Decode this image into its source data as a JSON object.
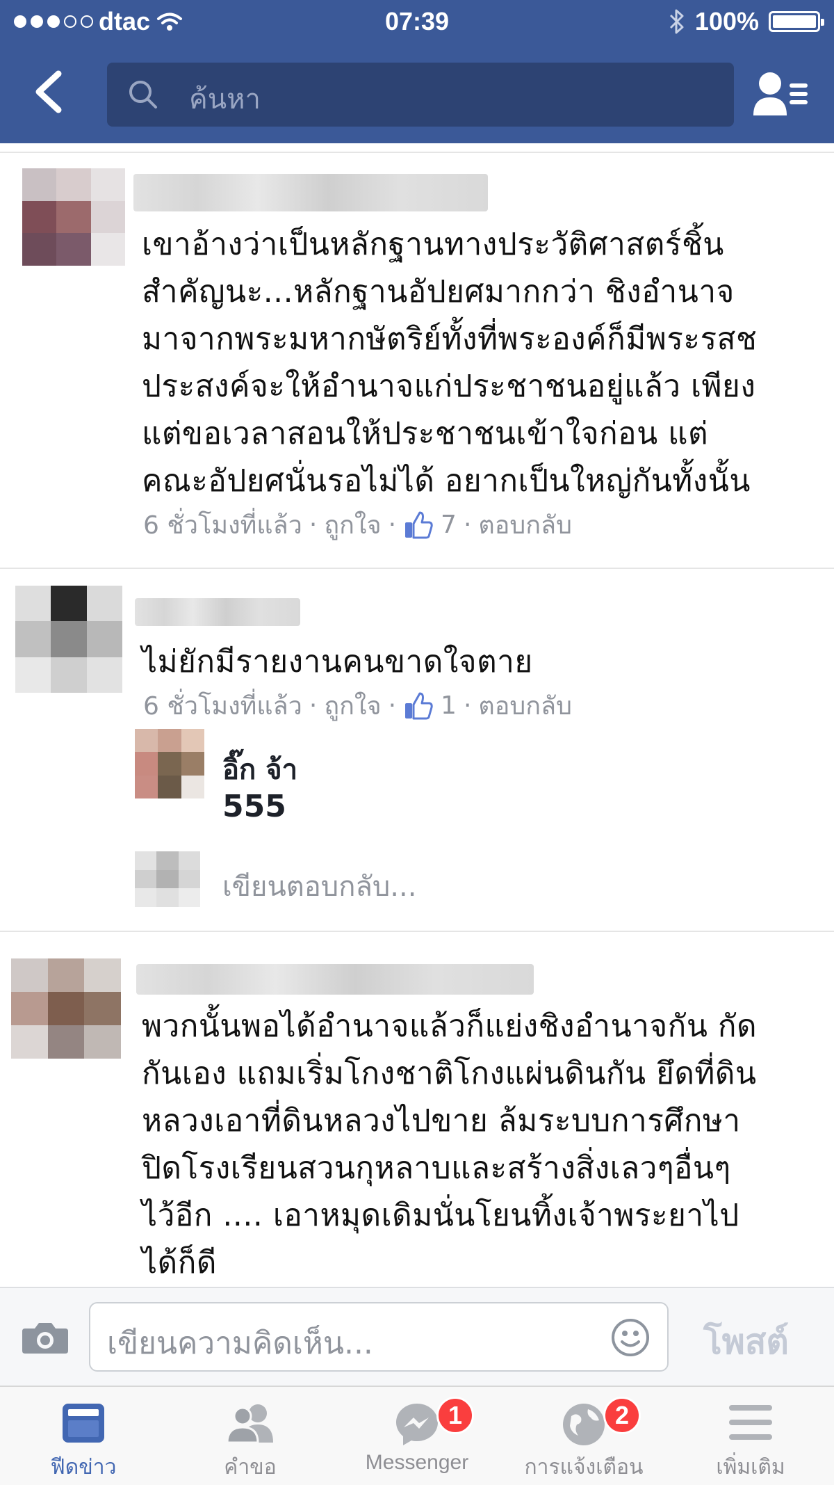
{
  "status_bar": {
    "carrier": "dtac",
    "time": "07:39",
    "battery": "100%"
  },
  "nav": {
    "search_placeholder": "ค้นหา"
  },
  "comments": [
    {
      "text": "เขาอ้างว่าเป็นหลักฐานทางประวัติศาสตร์ชิ้น\nสำคัญนะ...หลักฐานอัปยศมากกว่า  ชิงอำนาจ\nมาจากพระมหากษัตริย์ทั้งที่พระองค์ก็มีพระรสช\nประสงค์จะให้อำนาจแก่ประชาชนอยู่แล้ว เพียง\nแต่ขอเวลาสอนให้ประชาชนเข้าใจก่อน  แต่\nคณะอัปยศนั่นรอไม่ได้  อยากเป็นใหญ่กันทั้งนั้น",
      "time": "6 ชั่วโมงที่แล้ว",
      "like_label": "ถูกใจ",
      "likes": "7",
      "reply_label": "ตอบกลับ"
    },
    {
      "text": "ไม่ยักมีรายงานคนขาดใจตาย",
      "time": "6 ชั่วโมงที่แล้ว",
      "like_label": "ถูกใจ",
      "likes": "1",
      "reply_label": "ตอบกลับ",
      "reply": {
        "name": "อิ๊ก จ้า",
        "text": "555"
      },
      "write_reply": "เขียนตอบกลับ..."
    },
    {
      "text": "พวกนั้นพอได้อำนาจแล้วก็แย่งชิงอำนาจกัน กัด\nกันเอง แถมเริ่มโกงชาติโกงแผ่นดินกัน ยึดที่ดิน\nหลวงเอาที่ดินหลวงไปขาย ล้มระบบการศึกษา\nปิดโรงเรียนสวนกุหลาบและสร้างสิ่งเลวๆอื่นๆ\nไว้อีก .... เอาหมุดเดิมนั่นโยนทิ้งเจ้าพระยาไป\nได้ก็ดี"
    }
  ],
  "composer": {
    "placeholder": "เขียนความคิดเห็น...",
    "post_label": "โพสต์"
  },
  "tabs": [
    {
      "label": "ฟีดข่าว",
      "icon": "news-feed-icon"
    },
    {
      "label": "คำขอ",
      "icon": "friend-requests-icon"
    },
    {
      "label": "Messenger",
      "icon": "messenger-icon",
      "badge": "1"
    },
    {
      "label": "การแจ้งเตือน",
      "icon": "globe-icon",
      "badge": "2"
    },
    {
      "label": "เพิ่มเติม",
      "icon": "menu-icon"
    }
  ],
  "colors": {
    "header": "#3b5998",
    "accent": "#4267b2",
    "badge": "#fa3e3e"
  }
}
